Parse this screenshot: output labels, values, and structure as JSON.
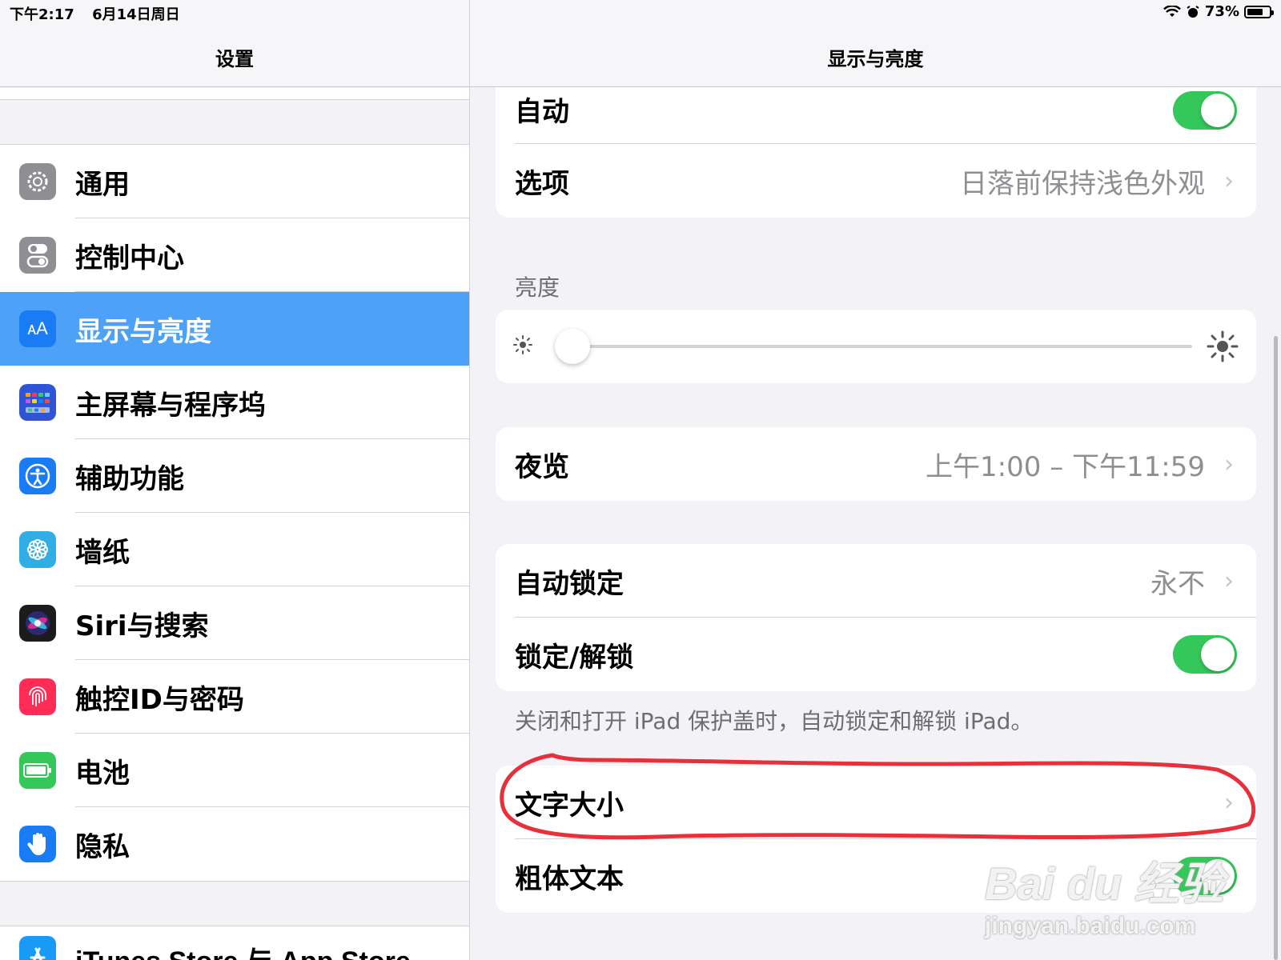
{
  "status_bar": {
    "time": "下午2:17",
    "date": "6月14日周日",
    "battery": "73%",
    "battery_level": 0.73
  },
  "sidebar": {
    "title": "设置",
    "items": [
      {
        "label": "通用",
        "icon": "gear-icon",
        "color": "#8e8e93",
        "selected": false
      },
      {
        "label": "控制中心",
        "icon": "toggles-icon",
        "color": "#8e8e93",
        "selected": false
      },
      {
        "label": "显示与亮度",
        "icon": "text-size-icon",
        "color": "#1a7cf5",
        "selected": true
      },
      {
        "label": "主屏幕与程序坞",
        "icon": "home-grid-icon",
        "color": "#2f55d4",
        "selected": false
      },
      {
        "label": "辅助功能",
        "icon": "accessibility-icon",
        "color": "#1a7cf5",
        "selected": false
      },
      {
        "label": "墙纸",
        "icon": "flower-icon",
        "color": "#32ade6",
        "selected": false
      },
      {
        "label": "Siri与搜索",
        "icon": "siri-icon",
        "color": "#1c1c1e",
        "selected": false
      },
      {
        "label": "触控ID与密码",
        "icon": "fingerprint-icon",
        "color": "#ff2d55",
        "selected": false
      },
      {
        "label": "电池",
        "icon": "battery-icon",
        "color": "#34c759",
        "selected": false
      },
      {
        "label": "隐私",
        "icon": "hand-icon",
        "color": "#1a7cf5",
        "selected": false
      }
    ],
    "bottom_item": {
      "label": "iTunes Store 与 App Store",
      "icon": "app-store-icon",
      "color": "#1a9af7"
    }
  },
  "detail": {
    "title": "显示与亮度",
    "appearance": {
      "auto_label": "自动",
      "auto_on": true,
      "options_label": "选项",
      "options_value": "日落前保持浅色外观"
    },
    "brightness": {
      "section_label": "亮度",
      "level": 0.02
    },
    "night_shift": {
      "label": "夜览",
      "value": "上午1:00 – 下午11:59"
    },
    "lock": {
      "auto_lock_label": "自动锁定",
      "auto_lock_value": "永不",
      "lock_unlock_label": "锁定/解锁",
      "lock_unlock_on": true,
      "footer": "关闭和打开 iPad 保护盖时，自动锁定和解锁 iPad。"
    },
    "text": {
      "text_size_label": "文字大小",
      "bold_text_label": "粗体文本",
      "bold_text_on": true
    }
  },
  "colors": {
    "accent": "#4da1f7",
    "toggle_on": "#34c759",
    "annotation": "#e8303a"
  },
  "watermark": {
    "main": "Bai du 经验",
    "sub": "jingyan.baidu.com"
  }
}
